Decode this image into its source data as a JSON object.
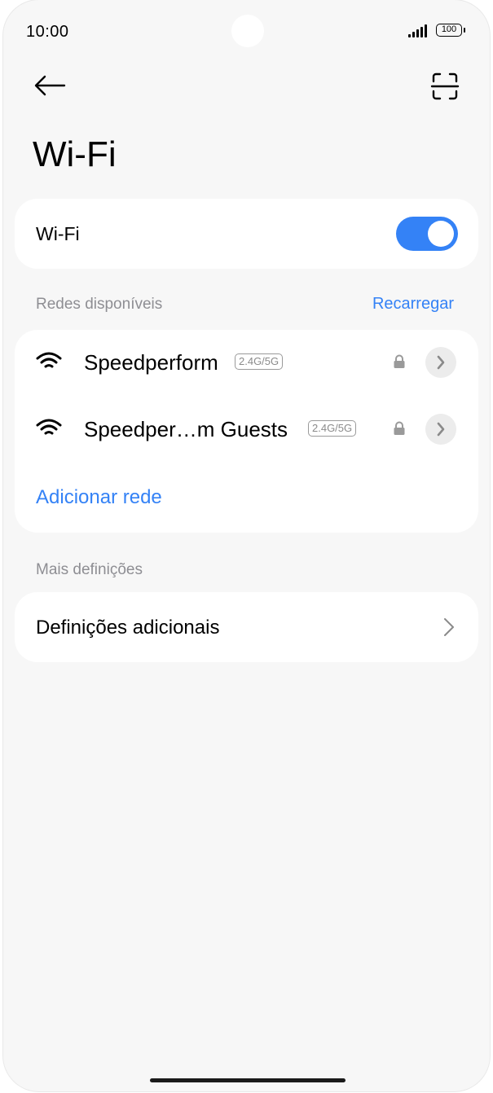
{
  "status_bar": {
    "time": "10:00",
    "battery": "100"
  },
  "header": {
    "title": "Wi-Fi"
  },
  "wifi_toggle": {
    "label": "Wi-Fi",
    "enabled": true
  },
  "available_networks": {
    "header": "Redes disponíveis",
    "refresh_label": "Recarregar",
    "networks": [
      {
        "name": "Speedperform",
        "band": "2.4G/5G",
        "secured": true
      },
      {
        "name": "Speedper…m Guests",
        "band": "2.4G/5G",
        "secured": true
      }
    ],
    "add_network_label": "Adicionar rede"
  },
  "more_settings": {
    "header": "Mais definições",
    "item_label": "Definições adicionais"
  },
  "colors": {
    "accent": "#3482f6",
    "background": "#f7f7f7",
    "card": "#ffffff"
  }
}
